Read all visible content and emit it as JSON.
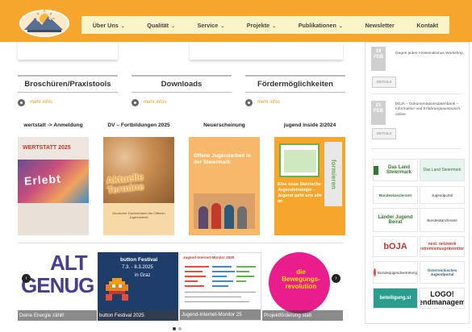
{
  "nav": {
    "items": [
      {
        "label": "Über Uns",
        "has_dropdown": true
      },
      {
        "label": "Qualität",
        "has_dropdown": true
      },
      {
        "label": "Service",
        "has_dropdown": true
      },
      {
        "label": "Projekte",
        "has_dropdown": true
      },
      {
        "label": "Publikationen",
        "has_dropdown": true
      },
      {
        "label": "Newsletter",
        "has_dropdown": false
      },
      {
        "label": "Kontakt",
        "has_dropdown": false
      }
    ]
  },
  "columns": [
    {
      "title": "Broschüren/Praxistools",
      "more": "mehr infos"
    },
    {
      "title": "Downloads",
      "more": "mehr infos"
    },
    {
      "title": "Fördermöglichkeiten",
      "more": "mehr infos"
    }
  ],
  "thumbnails": [
    {
      "title": "wertstatt -> Anmeldung",
      "cover": {
        "heading": "WERTSTATT 2025",
        "subtext": "Erlebt"
      }
    },
    {
      "title": "DV – Fortbildungen 2025",
      "cover": {
        "heading": "Aktuelle Termine",
        "subtext": "Deutscher Dachverband der Offenen Jugendarbeit"
      }
    },
    {
      "title": "Neuerscheinung",
      "cover": {
        "heading": "Offene Jugendarbeit in der Steiermark"
      }
    },
    {
      "title": "jugend inside 2/2024",
      "cover": {
        "heading": "Eine neue Steirische Jugendstrategie – Jugend geht uns alle an",
        "side": "formieren"
      }
    }
  ],
  "slides": [
    {
      "caption": "Deine Energie zählt!",
      "line1": "ALT",
      "line2": "GENUG"
    },
    {
      "caption": "button Festival 2025",
      "heading": "button Festival",
      "dates": "7.3. - 8.3.2025",
      "place": "in Graz"
    },
    {
      "caption": "Jugend-Internet-Monitor 25",
      "heading": "Jugend-Internet-Monitor 2025"
    },
    {
      "caption": "Projektförderung statt",
      "line1": "die",
      "line2": "Bewegungs-",
      "line3": "revolution"
    }
  ],
  "sidebar": {
    "events": [
      {
        "date_day": "19",
        "date_month": "FEB",
        "text": "Gegen jeden Antisemitismus Workshop",
        "button": "DETAILS"
      },
      {
        "date_day": "21",
        "date_month": "FEB",
        "text": "bOJA – Dokumentationsdatenbank – Information und Erfahrungsaustausch, online",
        "button": "DETAILS"
      }
    ],
    "logos": [
      {
        "label": "Das Land Steiermark"
      },
      {
        "label": "Das Land Steiermark"
      },
      {
        "label": "Bundeskanzleramt"
      },
      {
        "label": "Jugendportal"
      },
      {
        "label": "Länder Jugend Beirat"
      },
      {
        "label": "Bundeskanzleramt"
      },
      {
        "label": "bOJA"
      },
      {
        "label": "next: netzwerk extremismusprävention"
      },
      {
        "label": "Österreichisches Jugendportal"
      },
      {
        "label": "LOGO! jugendmanagement"
      },
      {
        "label": "beteiligung.st"
      },
      {
        "label": "Bundesjugendvertretung"
      }
    ]
  },
  "colors": {
    "header": "#f6a52d",
    "nav_bg": "#fbf4c6",
    "link": "#e9962b"
  }
}
